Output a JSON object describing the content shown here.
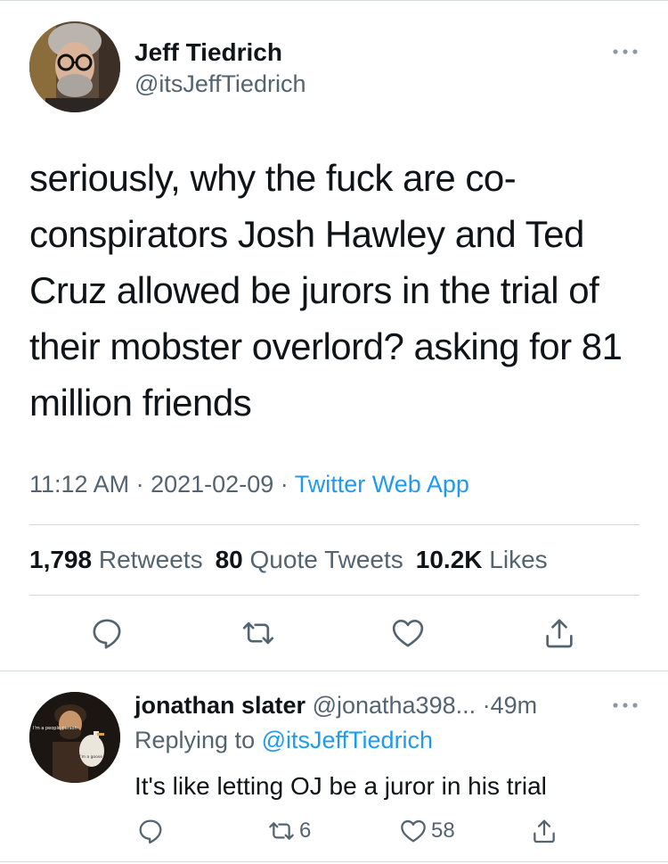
{
  "tweet": {
    "author_name": "Jeff Tiedrich",
    "author_handle": "@itsJeffTiedrich",
    "text": "seriously, why the fuck are co-conspirators Josh Hawley and Ted Cruz allowed be jurors in the trial of their mobster overlord? asking for 81 million friends",
    "time": "11:12 AM",
    "date": "2021-02-09",
    "separator": "·",
    "source": "Twitter Web App"
  },
  "stats": {
    "retweets_count": "1,798",
    "retweets_label": "Retweets",
    "quotes_count": "80",
    "quotes_label": "Quote Tweets",
    "likes_count": "10.2K",
    "likes_label": "Likes"
  },
  "actions": [
    "reply-icon",
    "retweet-icon",
    "like-icon",
    "share-icon"
  ],
  "reply": {
    "author_name": "jonathan slater",
    "author_handle": "@jonatha398...",
    "separator": "·",
    "time": "49m",
    "replying_prefix": "Replying to",
    "replying_handle": "@itsJeffTiedrich",
    "text": "It's like letting OJ be a juror in his trial",
    "retweet_count": "6",
    "like_count": "58",
    "avatar_caption_top": "I'm a people person",
    "avatar_caption_bottom": "I'm a goose"
  },
  "colors": {
    "text": "#0f1419",
    "secondary": "#536471",
    "accent": "#1d9bf0",
    "divider": "#cfd9de"
  }
}
